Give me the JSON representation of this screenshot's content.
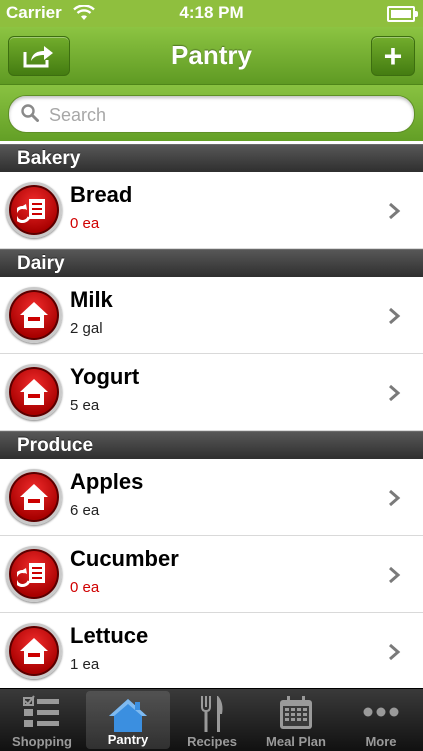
{
  "status_bar": {
    "carrier": "Carrier",
    "time": "4:18 PM"
  },
  "nav": {
    "title": "Pantry",
    "add_label": "+"
  },
  "search": {
    "placeholder": "Search"
  },
  "sections": [
    {
      "header": "Bakery",
      "items": [
        {
          "name": "Bread",
          "qty": "0 ea",
          "icon": "list-return-icon"
        }
      ]
    },
    {
      "header": "Dairy",
      "items": [
        {
          "name": "Milk",
          "qty": "2 gal",
          "icon": "house-minus-icon"
        },
        {
          "name": "Yogurt",
          "qty": "5 ea",
          "icon": "house-minus-icon"
        }
      ]
    },
    {
      "header": "Produce",
      "items": [
        {
          "name": "Apples",
          "qty": "6 ea",
          "icon": "house-minus-icon"
        },
        {
          "name": "Cucumber",
          "qty": "0 ea",
          "icon": "list-return-icon"
        },
        {
          "name": "Lettuce",
          "qty": "1 ea",
          "icon": "house-minus-icon"
        }
      ]
    }
  ],
  "tabs": [
    {
      "label": "Shopping",
      "icon": "checklist-icon"
    },
    {
      "label": "Pantry",
      "icon": "house-icon"
    },
    {
      "label": "Recipes",
      "icon": "fork-knife-icon"
    },
    {
      "label": "Meal Plan",
      "icon": "calendar-icon"
    },
    {
      "label": "More",
      "icon": "more-dots-icon"
    }
  ],
  "colors": {
    "accent_green": "#6faa2c",
    "low_stock_red": "#d00000",
    "active_tab_blue": "#3b8fe0"
  }
}
